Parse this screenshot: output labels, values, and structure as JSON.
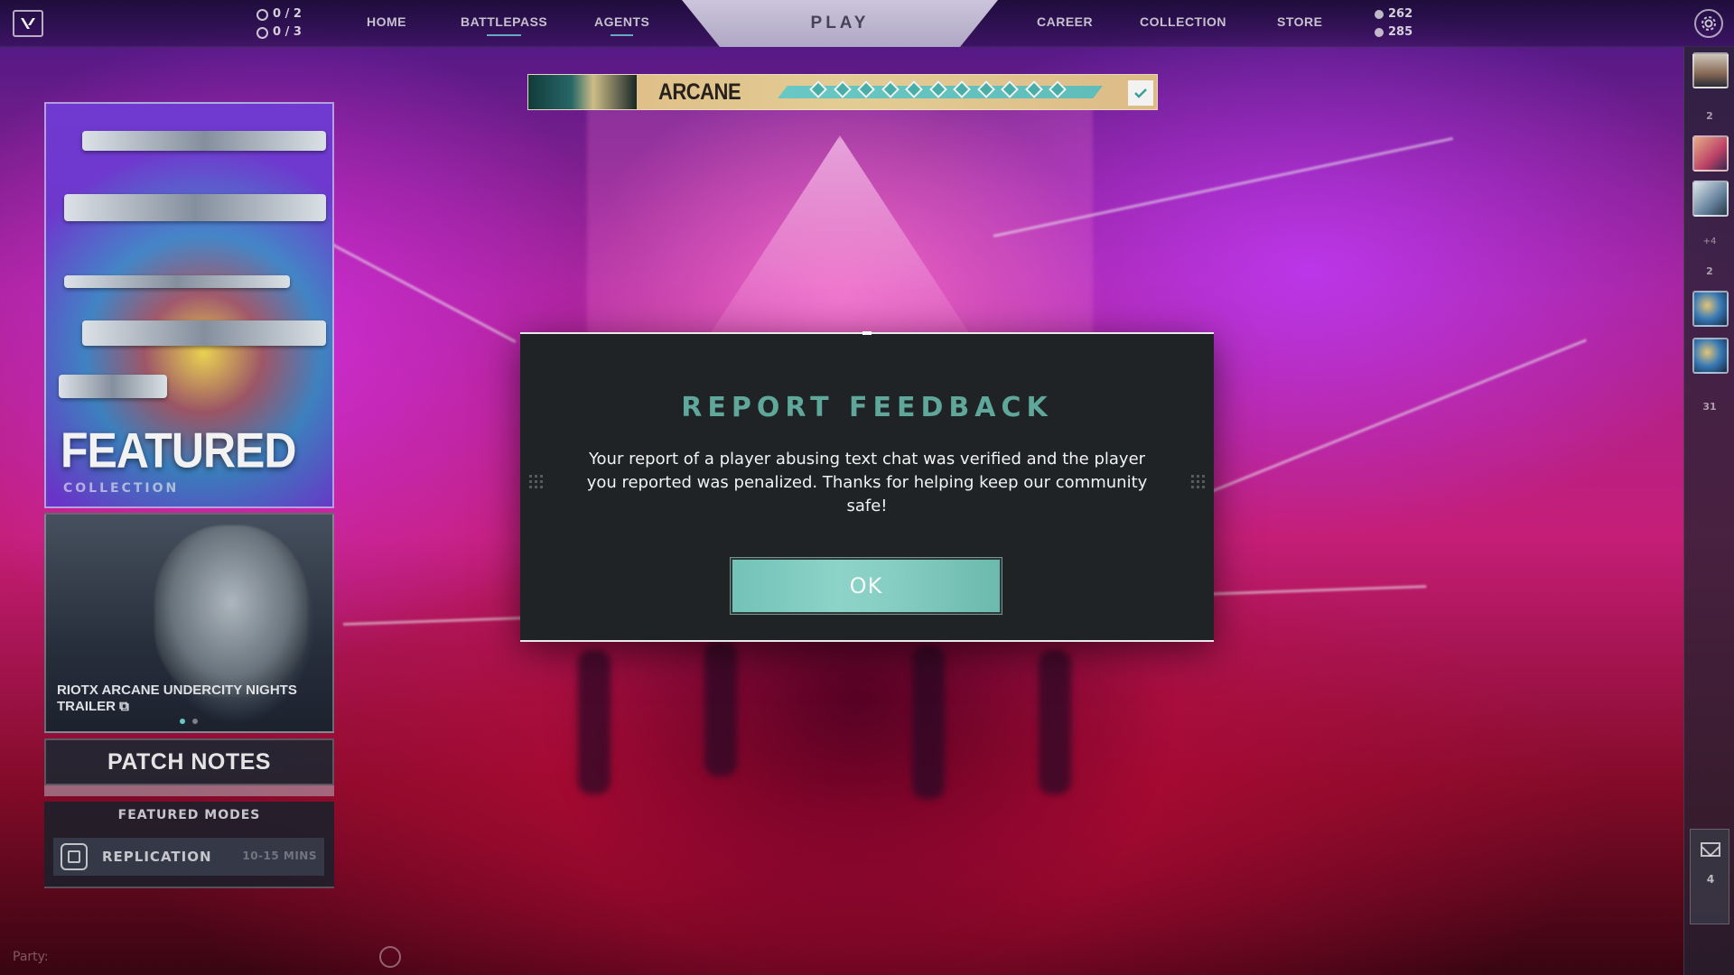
{
  "topbar": {
    "counters": {
      "first": "0 / 2",
      "second": "0 / 3"
    },
    "nav": {
      "home": "HOME",
      "battlepass": "BATTLEPASS",
      "agents": "AGENTS",
      "play": "PLAY",
      "career": "CAREER",
      "collection": "COLLECTION",
      "store": "STORE"
    },
    "points": {
      "valorant_points": "262",
      "radianite_points": "285"
    }
  },
  "battlepass_banner": {
    "title": "ARCANE",
    "tiers_shown": 11
  },
  "featured_card": {
    "title": "FEATURED",
    "subtitle": "COLLECTION"
  },
  "trailer_card": {
    "caption": "RIOTX ARCANE UNDERCITY NIGHTS TRAILER",
    "external_icon": "external-link-icon"
  },
  "patch_notes": {
    "label": "PATCH NOTES"
  },
  "featured_modes": {
    "title": "FEATURED MODES",
    "modes": [
      {
        "name": "REPLICATION",
        "duration": "10-15 MINS"
      }
    ]
  },
  "party": {
    "label": "Party:"
  },
  "sidebar": {
    "counts": {
      "group1": "2",
      "group1_extra": "+4",
      "group2": "2",
      "group3": "31"
    },
    "mail_count": "4"
  },
  "modal": {
    "title": "REPORT FEEDBACK",
    "body": "Your report of a player abusing text chat was verified and the player you reported was penalized. Thanks for helping keep our community safe!",
    "ok_label": "OK"
  },
  "colors": {
    "modal_bg": "#1f2326",
    "title_teal": "#5fa79a",
    "button_teal": "#86cdc3",
    "banner_gold": "#f0d79c"
  }
}
